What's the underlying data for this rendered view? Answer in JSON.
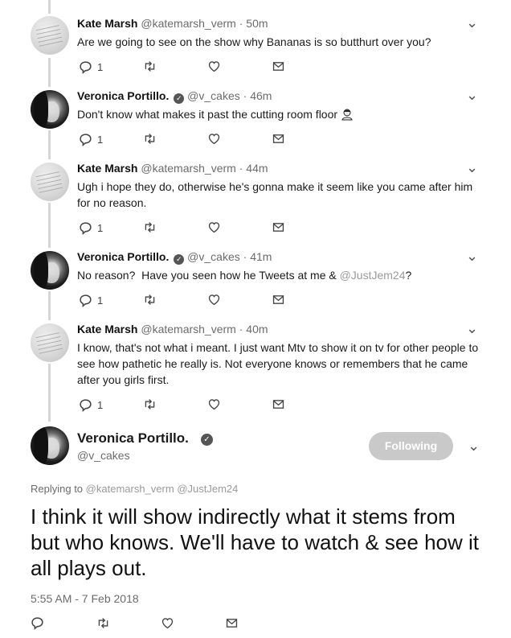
{
  "tweets": [
    {
      "name": "Kate Marsh",
      "handle": "@katemarsh_verm",
      "dot": "·",
      "time": "50m",
      "text": "Are we going to see on the show why Bananas is so butthurt over you?",
      "reply_count": "1"
    },
    {
      "name": "Veronica Portillo.",
      "handle": "@v_cakes",
      "dot": "·",
      "time": "46m",
      "text": "Don't know what makes it past the cutting room floor",
      "reply_count": "1",
      "emoji": "woman-shrugging-emoji"
    },
    {
      "name": "Kate Marsh",
      "handle": "@katemarsh_verm",
      "dot": "·",
      "time": "44m",
      "text": "Ugh i hope they do, otherwise he's gonna make it seem like you came after him for no reason.",
      "reply_count": "1"
    },
    {
      "name": "Veronica Portillo.",
      "handle": "@v_cakes",
      "dot": "·",
      "time": "41m",
      "text_before": "No reason?  Have you seen how he Tweets at me & ",
      "mention": "@JustJem24",
      "text_after": "?",
      "reply_count": "1"
    },
    {
      "name": "Kate Marsh",
      "handle": "@katemarsh_verm",
      "dot": "·",
      "time": "40m",
      "text": "I know, that's not what i meant. I just want Mtv to show it on tv for other people to see how pathetic he really is. Not everyone knows or remembers that he came after you girls first.",
      "reply_count": "1"
    }
  ],
  "main_tweet": {
    "name": "Veronica Portillo.",
    "handle": "@v_cakes",
    "follow_label": "Following",
    "replying_label": "Replying to",
    "replying_mentions": [
      "@katemarsh_verm",
      "@JustJem24"
    ],
    "text": "I think it will show indirectly what it stems from but who knows.  We'll have to watch & see how it all plays out.",
    "timestamp": "5:55 AM - 7 Feb 2018"
  },
  "icons": [
    "reply-icon",
    "retweet-icon",
    "like-icon",
    "message-icon",
    "chevron-down-icon",
    "verified-icon"
  ],
  "colors": {
    "muted": "#6b6b6b",
    "mention": "#9a9a9a",
    "button_bg": "#c9c9c9",
    "thread_line": "#d6d6d6"
  }
}
